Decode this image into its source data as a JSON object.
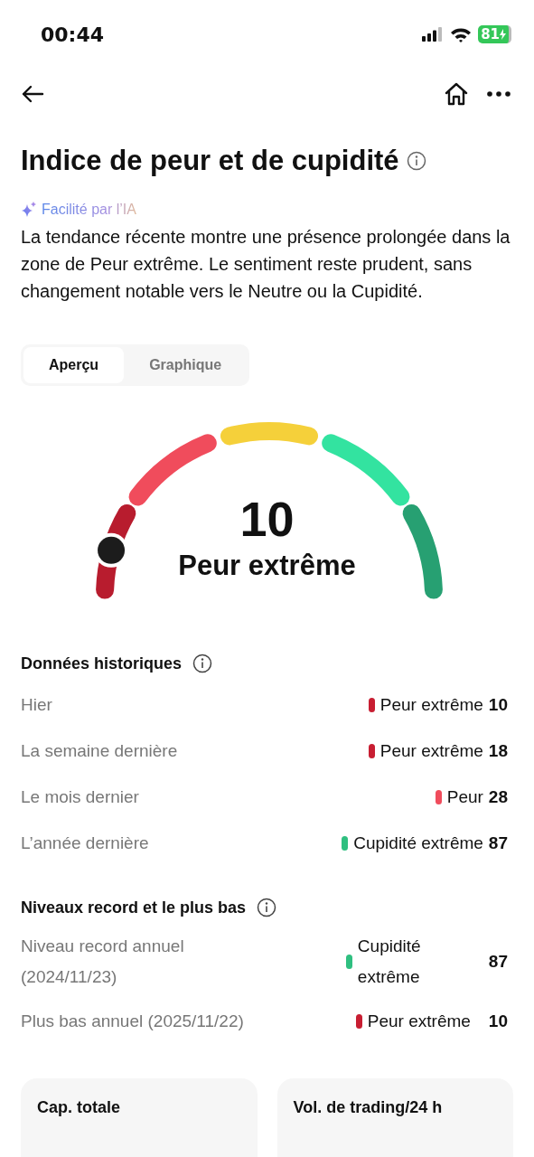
{
  "status_bar": {
    "time": "00:44",
    "battery": "81"
  },
  "title": "Indice de peur et de cupidité",
  "ai_label": "Facilité par l’IA",
  "summary": "La tendance récente montre une présence prolongée dans la zone de Peur extrême. Le sentiment reste prudent, sans changement notable vers le Neutre ou la Cupidité.",
  "tabs": [
    {
      "label": "Aperçu",
      "selected": true
    },
    {
      "label": "Graphique",
      "selected": false
    }
  ],
  "gauge": {
    "value": "10",
    "label": "Peur extrême",
    "zones": [
      {
        "color": "#b81c2e"
      },
      {
        "color": "#f04c5c"
      },
      {
        "color": "#f5d03a"
      },
      {
        "color": "#33e3a0"
      },
      {
        "color": "#27a072"
      }
    ]
  },
  "historical": {
    "title": "Données historiques",
    "rows": [
      {
        "label": "Hier",
        "status": "Peur extrême",
        "value": "10",
        "color": "#c81e32"
      },
      {
        "label": "La semaine dernière",
        "status": "Peur extrême",
        "value": "18",
        "color": "#c81e32"
      },
      {
        "label": "Le mois dernier",
        "status": "Peur",
        "value": "28",
        "color": "#f04c5c"
      },
      {
        "label": "L’année dernière",
        "status": "Cupidité extrême",
        "value": "87",
        "color": "#2fbf80"
      }
    ]
  },
  "records": {
    "title": "Niveaux record et le plus bas",
    "rows": [
      {
        "label": "Niveau record annuel (2024/11/23)",
        "status": "Cupidité extrême",
        "value": "87",
        "color": "#2fbf80"
      },
      {
        "label": "Plus bas annuel (2025/11/22)",
        "status": "Peur extrême",
        "value": "10",
        "color": "#c81e32"
      }
    ]
  },
  "cards": [
    {
      "title": "Cap. totale"
    },
    {
      "title": "Vol. de trading/24 h"
    }
  ]
}
